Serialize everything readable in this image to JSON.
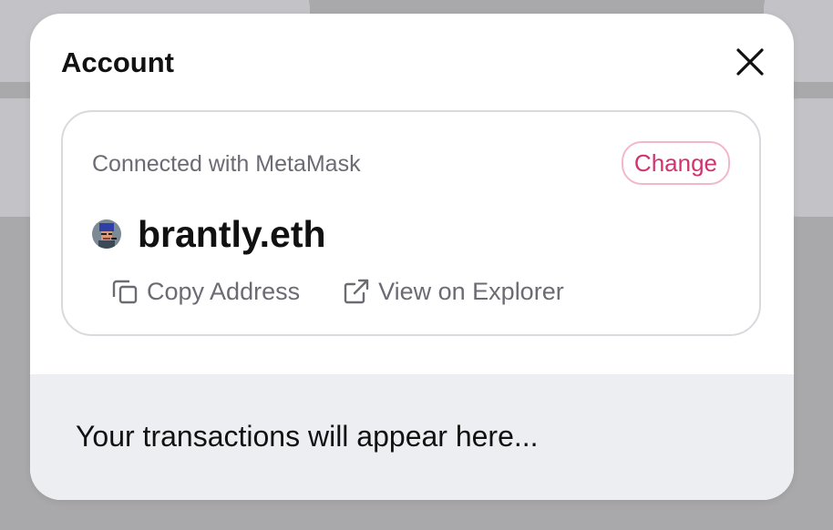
{
  "modal": {
    "title": "Account",
    "close_icon": "close-icon"
  },
  "connection": {
    "label": "Connected with MetaMask",
    "change_label": "Change",
    "accent_color": "#d0336f"
  },
  "account": {
    "ens_name": "brantly.eth",
    "avatar_icon": "avatar-image"
  },
  "actions": {
    "copy_label": "Copy Address",
    "copy_icon": "copy-icon",
    "explorer_label": "View on Explorer",
    "explorer_icon": "external-link-icon"
  },
  "transactions": {
    "empty_message": "Your transactions will appear here..."
  }
}
